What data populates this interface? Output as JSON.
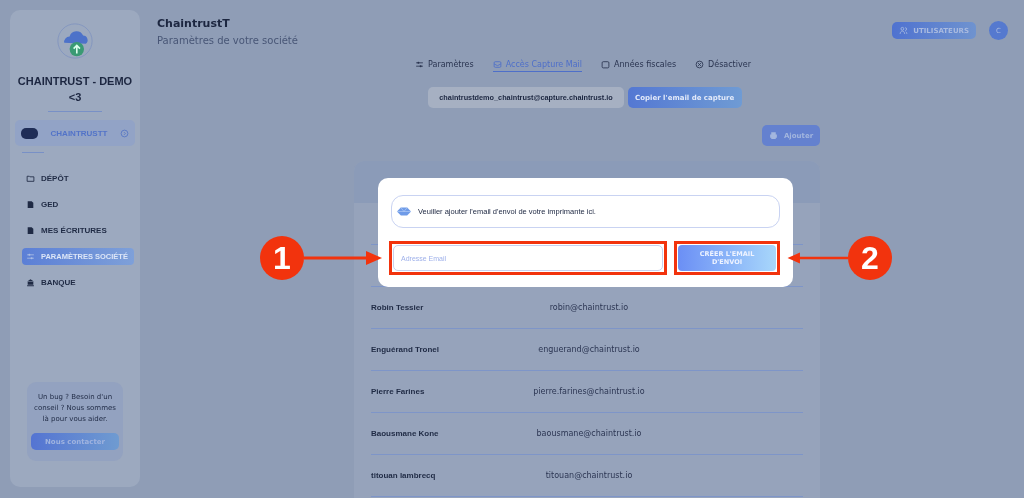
{
  "sidebar": {
    "company_name": "CHAINTRUST - DEMO <3",
    "current_company": "CHAINTRUSTT",
    "nav": [
      {
        "label": "DÉPÔT",
        "kind": "folder",
        "selected": false
      },
      {
        "label": "GED",
        "kind": "document",
        "selected": false
      },
      {
        "label": "MES ÉCRITURES",
        "kind": "document",
        "selected": false
      },
      {
        "label": "PARAMÈTRES SOCIÉTÉ",
        "kind": "sliders",
        "selected": true
      },
      {
        "label": "BANQUE",
        "kind": "bank",
        "selected": false
      }
    ],
    "help": {
      "text": "Un bug ? Besoin d'un conseil ? Nous sommes là pour vous aider.",
      "button": "Nous contacter"
    }
  },
  "header": {
    "title": "ChaintrustT",
    "subtitle": "Paramètres de votre société",
    "users_button": "UTILISATEURS",
    "avatar": "C"
  },
  "tabs": [
    {
      "label": "Paramètres",
      "kind": "sliders",
      "selected": false
    },
    {
      "label": "Accès Capture Mail",
      "kind": "mail",
      "selected": true
    },
    {
      "label": "Années fiscales",
      "kind": "calendar",
      "selected": false
    },
    {
      "label": "Désactiver",
      "kind": "cancel",
      "selected": false
    }
  ],
  "capture_email": {
    "value": "chaintrustdemo_chaintrust@capture.chaintrust.io",
    "copy_button": "Copier l'email de capture"
  },
  "add_button": "Ajouter",
  "table": {
    "rows": [
      {
        "name": "Robin Tessier",
        "email": "robin@chaintrust.io"
      },
      {
        "name": "Enguérand Tronel",
        "email": "enguerand@chaintrust.io"
      },
      {
        "name": "Pierre Farines",
        "email": "pierre.farines@chaintrust.io"
      },
      {
        "name": "Baousmane Kone",
        "email": "baousmane@chaintrust.io"
      },
      {
        "name": "titouan lambrecq",
        "email": "titouan@chaintrust.io"
      }
    ]
  },
  "modal": {
    "info": "Veuiller ajouter l'email d'envoi de votre imprimante ici.",
    "email_field": {
      "placeholder": "Adresse Email"
    },
    "submit_button": "CRÉER L'EMAIL D'ENVOI"
  },
  "annotations": [
    {
      "number": "1"
    },
    {
      "number": "2"
    }
  ]
}
